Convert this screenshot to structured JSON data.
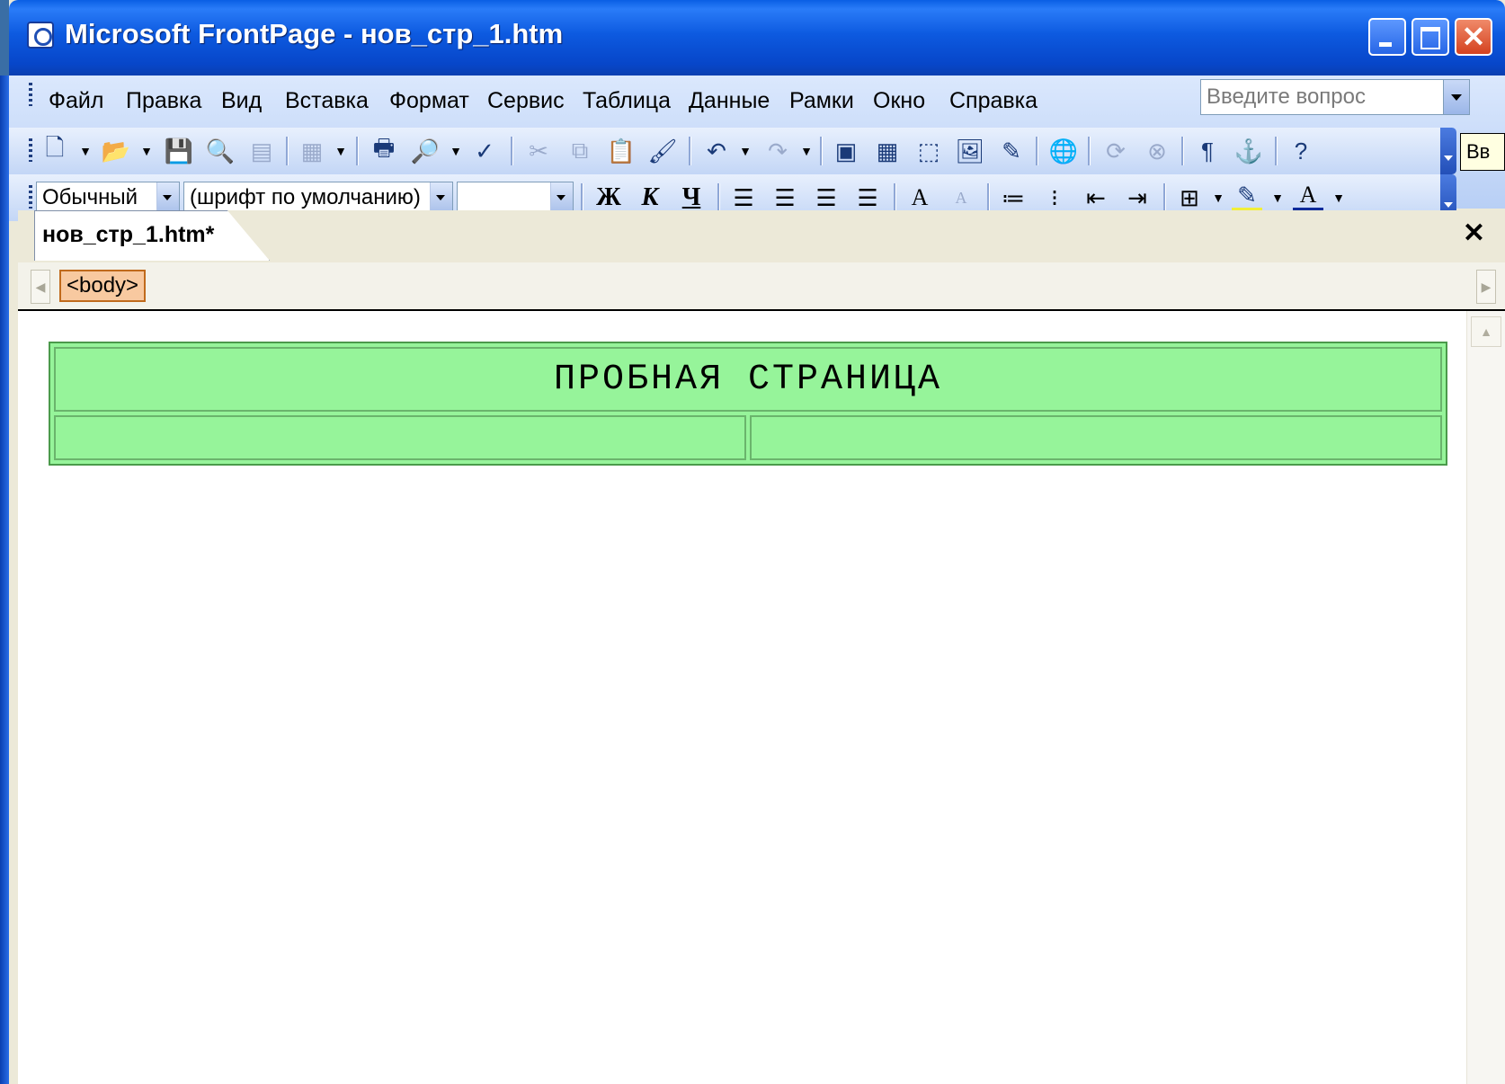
{
  "window": {
    "title": "Microsoft FrontPage - нов_стр_1.htm"
  },
  "menu": {
    "items": [
      "Файл",
      "Правка",
      "Вид",
      "Вставка",
      "Формат",
      "Сервис",
      "Таблица",
      "Данные",
      "Рамки",
      "Окно",
      "Справка"
    ]
  },
  "ask": {
    "placeholder": "Введите вопрос"
  },
  "tooltip_clip": "Вв",
  "formatting": {
    "style": "Обычный",
    "font": "(шрифт по умолчанию)",
    "size": "",
    "bold_label": "Ж",
    "italic_label": "К",
    "underline_label": "Ч"
  },
  "document": {
    "tab_label": "нов_стр_1.htm*",
    "tag": "<body>",
    "table_heading": "ПРОБНАЯ СТРАНИЦА",
    "table_bg": "#96f49a"
  }
}
